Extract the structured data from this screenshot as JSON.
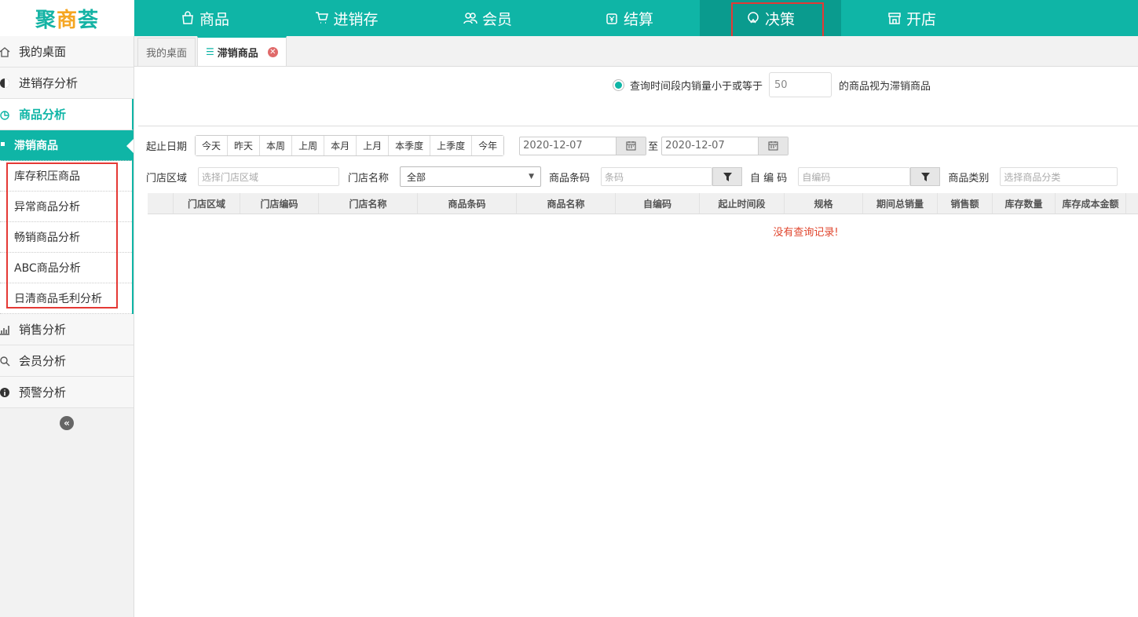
{
  "app": {
    "logo_left": "聚",
    "logo_mid": "商",
    "logo_right": "荟"
  },
  "topnav": [
    {
      "label": "商品",
      "icon": "bag-icon"
    },
    {
      "label": "进销存",
      "icon": "cart-icon"
    },
    {
      "label": "会员",
      "icon": "users-icon"
    },
    {
      "label": "结算",
      "icon": "yen-icon"
    },
    {
      "label": "决策",
      "icon": "decision-icon",
      "active": true
    },
    {
      "label": "开店",
      "icon": "store-icon"
    }
  ],
  "sidebar": {
    "items": [
      {
        "label": "我的桌面",
        "icon": "home-icon"
      },
      {
        "label": "进销存分析",
        "icon": "pie-icon"
      },
      {
        "label": "商品分析",
        "icon": "chart-icon",
        "open": true
      }
    ],
    "subitems": [
      {
        "label": "滞销商品",
        "active": true
      },
      {
        "label": "库存积压商品"
      },
      {
        "label": "异常商品分析"
      },
      {
        "label": "畅销商品分析"
      },
      {
        "label": "ABC商品分析"
      },
      {
        "label": "日清商品毛利分析"
      }
    ],
    "items_after": [
      {
        "label": "销售分析",
        "icon": "bar-chart-icon"
      },
      {
        "label": "会员分析",
        "icon": "search-user-icon"
      },
      {
        "label": "预警分析",
        "icon": "info-icon"
      }
    ],
    "collapse_glyph": "«"
  },
  "tabs": [
    {
      "label": "我的桌面"
    },
    {
      "label": "滞销商品",
      "active": true,
      "close": "✕"
    }
  ],
  "condition": {
    "prefix": "查询时间段内销量小于或等于",
    "value": "50",
    "suffix": "的商品视为滞销商品"
  },
  "filters": {
    "date_label": "起止日期",
    "date_presets": [
      "今天",
      "昨天",
      "本周",
      "上周",
      "本月",
      "上月",
      "本季度",
      "上季度",
      "今年"
    ],
    "start_date": "2020-12-07",
    "to_label": "至",
    "end_date": "2020-12-07",
    "area_label": "门店区域",
    "area_placeholder": "选择门店区域",
    "store_label": "门店名称",
    "store_value": "全部",
    "barcode_label": "商品条码",
    "barcode_placeholder": "条码",
    "selfcode_label": "自 编 码",
    "selfcode_placeholder": "自编码",
    "category_label": "商品类别",
    "category_placeholder": "选择商品分类"
  },
  "grid": {
    "columns": [
      "",
      "门店区域",
      "门店编码",
      "门店名称",
      "商品条码",
      "商品名称",
      "自编码",
      "起止时间段",
      "规格",
      "期间总销量",
      "销售额",
      "库存数量",
      "库存成本金额"
    ],
    "empty_text": "没有查询记录!"
  },
  "colors": {
    "brand": "#0fb5a6",
    "highlight_box": "#e53935",
    "empty_text": "#e0452d"
  }
}
